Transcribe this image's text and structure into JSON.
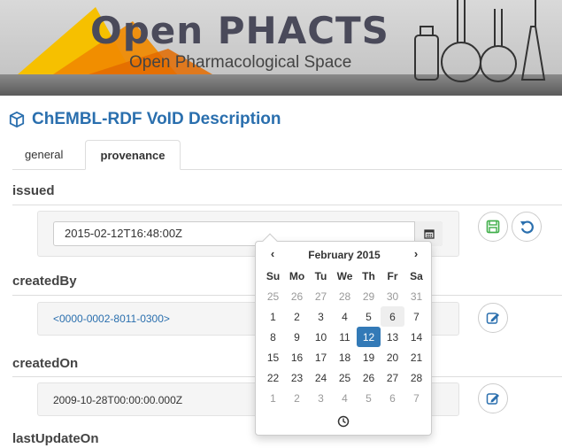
{
  "banner": {
    "title": "Open PHACTS",
    "subtitle": "Open Pharmacological Space",
    "colors": {
      "triangle_orange": "#f08a00",
      "triangle_yellow": "#f6c000"
    }
  },
  "page": {
    "title": "ChEMBL-RDF VoID Description",
    "icon": "cube-icon"
  },
  "tabs": [
    {
      "label": "general",
      "active": false
    },
    {
      "label": "provenance",
      "active": true
    }
  ],
  "fields": {
    "issued": {
      "label": "issued",
      "value": "2015-02-12T16:48:00Z"
    },
    "createdBy": {
      "label": "createdBy",
      "value": "<0000-0002-8011-0300>"
    },
    "createdOn": {
      "label": "createdOn",
      "value": "2009-10-28T00:00:00.000Z"
    },
    "lastUpdateOn": {
      "label": "lastUpdateOn"
    }
  },
  "icons": {
    "calendar": "calendar-icon",
    "save": "save-icon",
    "undo": "undo-icon",
    "edit": "edit-icon",
    "clock": "clock-icon"
  },
  "datepicker": {
    "prev": "‹",
    "next": "›",
    "month": "February 2015",
    "weekdays": [
      "Su",
      "Mo",
      "Tu",
      "We",
      "Th",
      "Fr",
      "Sa"
    ],
    "weeks": [
      [
        "25",
        "26",
        "27",
        "28",
        "29",
        "30",
        "31"
      ],
      [
        "1",
        "2",
        "3",
        "4",
        "5",
        "6",
        "7"
      ],
      [
        "8",
        "9",
        "10",
        "11",
        "12",
        "13",
        "14"
      ],
      [
        "15",
        "16",
        "17",
        "18",
        "19",
        "20",
        "21"
      ],
      [
        "22",
        "23",
        "24",
        "25",
        "26",
        "27",
        "28"
      ],
      [
        "1",
        "2",
        "3",
        "4",
        "5",
        "6",
        "7"
      ]
    ],
    "selected": "12",
    "hovered": "6"
  },
  "colors": {
    "accent": "#337ab7",
    "title": "#2a6fae",
    "green": "#3fae49"
  }
}
